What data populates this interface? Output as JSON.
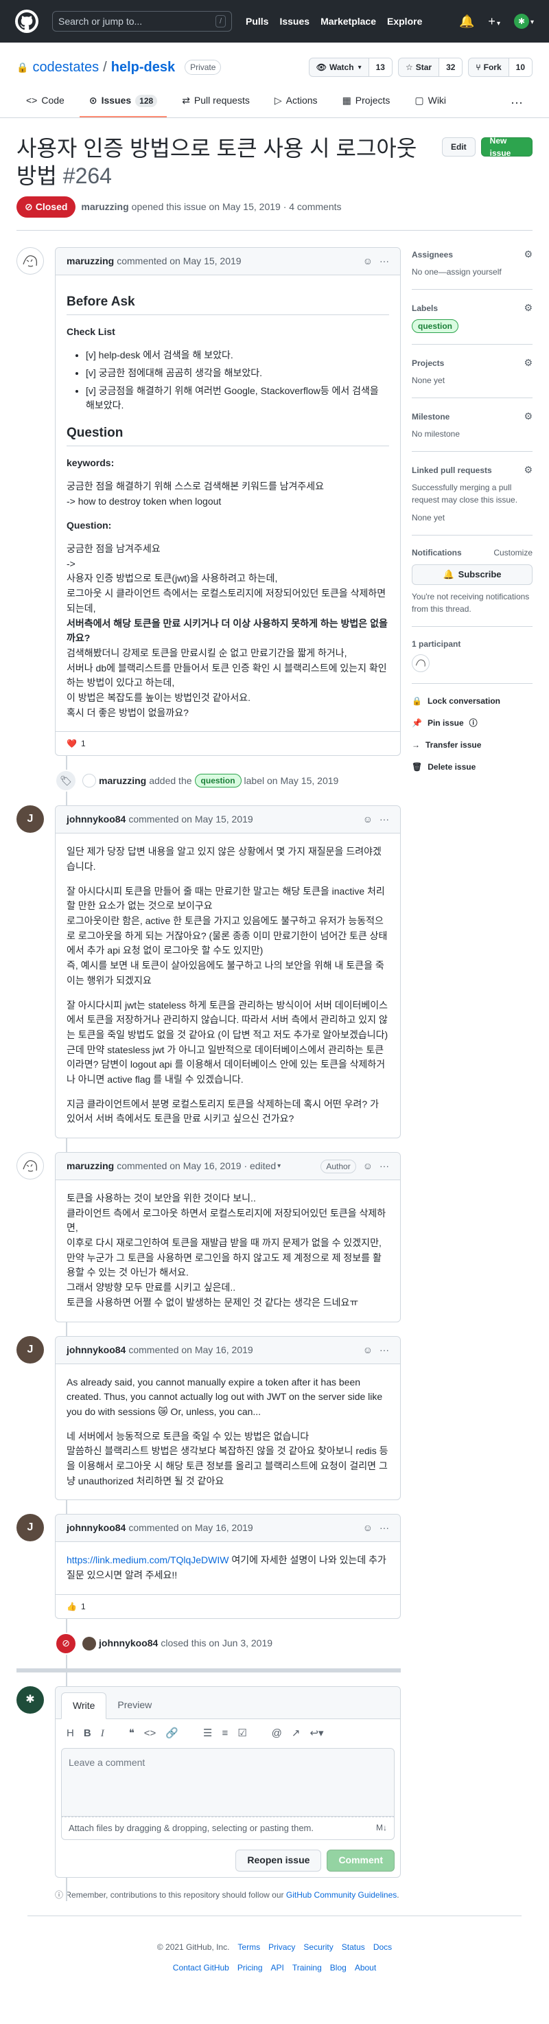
{
  "header": {
    "search_placeholder": "Search or jump to...",
    "slash_key": "/",
    "nav": [
      "Pulls",
      "Issues",
      "Marketplace",
      "Explore"
    ]
  },
  "repo": {
    "owner": "codestates",
    "sep": "/",
    "name": "help-desk",
    "visibility": "Private",
    "watch_label": "Watch",
    "watch_count": "13",
    "star_label": "Star",
    "star_count": "32",
    "fork_label": "Fork",
    "fork_count": "10",
    "tabs": {
      "code": "Code",
      "issues": "Issues",
      "issues_count": "128",
      "pulls": "Pull requests",
      "actions": "Actions",
      "projects": "Projects",
      "wiki": "Wiki"
    }
  },
  "issue": {
    "title": "사용자 인증 방법으로 토큰 사용 시 로그아웃 방법",
    "number": "#264",
    "edit_label": "Edit",
    "new_issue_label": "New issue",
    "state": "Closed",
    "author": "maruzzing",
    "meta": "opened this issue on May 15, 2019 · 4 comments"
  },
  "comments": {
    "c1": {
      "author": "maruzzing",
      "meta": "commented on May 15, 2019",
      "before_ask": "Before Ask",
      "check_list": "Check List",
      "checks": [
        "[v] help-desk 에서 검색을 해 보았다.",
        "[v] 궁금한 점에대해 곰곰히 생각을 해보았다.",
        "[v] 궁금점을 해결하기 위해 여러번 Google, Stackoverflow등 에서 검색을 해보았다."
      ],
      "question_h": "Question",
      "keywords_h": "keywords:",
      "keywords_1": "궁금한 점을 해결하기 위해 스스로 검색해본 키워드를 남겨주세요",
      "keywords_2": "-> how to destroy token when logout",
      "question_sub": "Question:",
      "q1": "궁금한 점을 남겨주세요",
      "q2": "->",
      "q3": "사용자 인증 방법으로 토큰(jwt)을 사용하려고 하는데,",
      "q4": "로그아웃 시 클라이언트 측에서는 로컬스토리지에 저장되어있던 토큰을 삭제하면 되는데,",
      "q5": "서버측에서 해당 토큰을 만료 시키거나 더 이상 사용하지 못하게 하는 방법은 없을까요?",
      "q6": "검색해봤더니 강제로 토큰을 만료시킬 순 없고 만료기간을 짧게 하거나,",
      "q7": "서버나 db에 블랙리스트를 만들어서 토큰 인증 확인 시 블랙리스트에 있는지 확인하는 방법이 있다고 하는데,",
      "q8": "이 방법은 복잡도를 높이는 방법인것 같아서요.",
      "q9": "혹시 더 좋은 방법이 없을까요?",
      "reaction": "❤️",
      "reaction_count": "1"
    },
    "label_event": {
      "actor": "maruzzing",
      "pre": "added the",
      "label": "question",
      "post": "label on May 15, 2019"
    },
    "c2": {
      "author": "johnnykoo84",
      "meta": "commented on May 15, 2019",
      "p1": "일단 제가 당장 답변 내용을 알고 있지 않은 상황에서 몇 가지 재질문을 드려야겠습니다.",
      "p2a": "잘 아시다시피 토큰을 만들어 줄 때는 만료기한 말고는 해당 토큰을 inactive 처리 할 만한 요소가 없는 것으로 보이구요",
      "p2b": "로그아웃이란 함은, active 한 토큰을 가지고 있음에도 불구하고 유저가 능동적으로 로그아웃을 하게 되는 거잖아요? (물론 종종 이미 만료기한이 넘어간 토큰 상태에서 추가 api 요청 없이 로그아웃 할 수도 있지만)",
      "p2c": "즉, 예시를 보면 내 토큰이 살아있음에도 불구하고 나의 보안을 위해 내 토큰을 죽이는 행위가 되겠지요",
      "p3": "잘 아시다시피 jwt는 stateless 하게 토큰을 관리하는 방식이어 서버 데이터베이스에서 토큰을 저장하거나 관리하지 않습니다. 따라서 서버 측에서 관리하고 있지 않는 토큰을 죽일 방법도 없을 것 같아요 (이 답변 적고 저도 추가로 알아보겠습니다) 근데 만약 statesless jwt 가 아니고 일반적으로 데이터베이스에서 관리하는 토큰이라면? 담변이 logout api 를 이용해서 데이터베이스 안에 있는 토큰을 삭제하거나 아니면 active flag 를 내릴 수 있겠습니다.",
      "p4": "지금 클라이언트에서 분명 로컬스토리지 토큰을 삭제하는데 혹시 어떤 우려? 가 있어서 서버 측에서도 토큰을 만료 시키고 싶으신 건가요?"
    },
    "c3": {
      "author": "maruzzing",
      "meta": "commented on May 16, 2019 · edited",
      "badge": "Author",
      "l1": "토큰을 사용하는 것이 보안을 위한 것이다 보니..",
      "l2": "클라이언트 측에서 로그아웃 하면서 로컬스토리지에 저장되어있던 토큰을 삭제하면,",
      "l3": "이후로 다시 재로그인하여 토큰을 재발급 받을 때 까지 문제가 없을 수 있겠지만,",
      "l4": "만약 누군가 그 토큰을 사용하면 로그인을 하지 않고도 제 계정으로 제 정보를 활용할 수 있는 것 아닌가 해서요.",
      "l5": "그래서 양방향 모두 만료를 시키고 싶은데..",
      "l6": "토큰을 사용하면 어쩔 수 없이 발생하는 문제인 것 같다는 생각은 드네요ㅠ"
    },
    "c4": {
      "author": "johnnykoo84",
      "meta": "commented on May 16, 2019",
      "p1": "As already said, you cannot manually expire a token after it has been created. Thus, you cannot actually log out with JWT on the server side like you do with sessions 😿 Or, unless, you can...",
      "p2a": "네 서버에서 능동적으로 토큰을 죽일 수 있는 방법은 없습니다",
      "p2b": "말씀하신 블랙리스트 방법은 생각보다 복잡하진 않을 것 같아요 찾아보니 redis 등을 이용해서 로그아웃 시 해당 토큰 정보를 올리고 블랙리스트에 요청이 걸리면 그냥 unauthorized 처리하면 될 것 같아요"
    },
    "c5": {
      "author": "johnnykoo84",
      "meta": "commented on May 16, 2019",
      "link": "https://link.medium.com/TQlqJeDWIW",
      "text": " 여기에 자세한 설명이 나와 있는데 추가 질문 있으시면 알려 주세요!!",
      "reaction": "👍",
      "reaction_count": "1"
    },
    "closed_event": {
      "actor": "johnnykoo84",
      "text": "closed this on Jun 3, 2019"
    }
  },
  "new_comment": {
    "tab_write": "Write",
    "tab_preview": "Preview",
    "placeholder": "Leave a comment",
    "attach": "Attach files by dragging & dropping, selecting or pasting them.",
    "reopen_label": "Reopen issue",
    "comment_label": "Comment",
    "tip_pre": "Remember, contributions to this repository should follow our ",
    "tip_link": "GitHub Community Guidelines",
    "tip_post": "."
  },
  "sidebar": {
    "assignees_h": "Assignees",
    "assignees_v": "No one—assign yourself",
    "labels_h": "Labels",
    "labels_v": "question",
    "projects_h": "Projects",
    "projects_v": "None yet",
    "milestone_h": "Milestone",
    "milestone_v": "No milestone",
    "linked_h": "Linked pull requests",
    "linked_desc": "Successfully merging a pull request may close this issue.",
    "linked_v": "None yet",
    "notif_h": "Notifications",
    "notif_customize": "Customize",
    "subscribe": "Subscribe",
    "notif_desc": "You're not receiving notifications from this thread.",
    "participants": "1 participant",
    "lock": "Lock conversation",
    "pin": "Pin issue",
    "transfer": "Transfer issue",
    "delete": "Delete issue"
  },
  "footer": {
    "copyright": "© 2021 GitHub, Inc.",
    "row1": [
      "Terms",
      "Privacy",
      "Security",
      "Status",
      "Docs"
    ],
    "row2": [
      "Contact GitHub",
      "Pricing",
      "API",
      "Training",
      "Blog",
      "About"
    ]
  },
  "colors": {
    "header_bg": "#24292f",
    "closed_red": "#cf222e",
    "primary_green": "#2da44e",
    "link_blue": "#0969da"
  }
}
